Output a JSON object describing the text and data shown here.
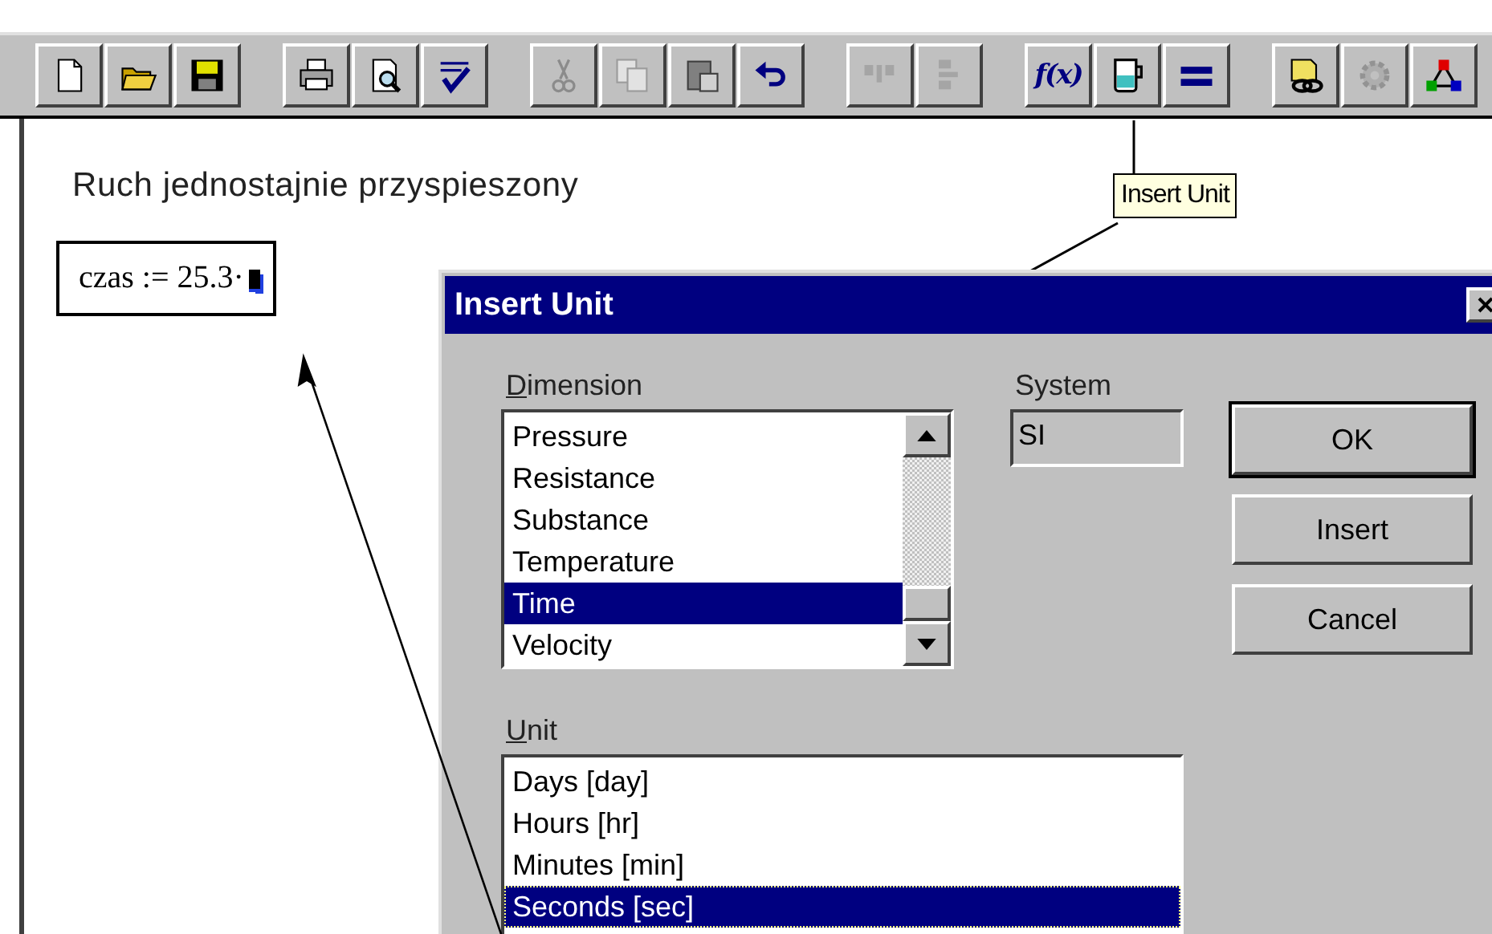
{
  "toolbar": {
    "groups": [
      {
        "buttons": [
          {
            "kind": "new",
            "disabled": false
          },
          {
            "kind": "open",
            "disabled": false
          },
          {
            "kind": "save",
            "disabled": false
          }
        ]
      },
      {
        "buttons": [
          {
            "kind": "print",
            "disabled": false
          },
          {
            "kind": "preview",
            "disabled": false
          },
          {
            "kind": "spell",
            "disabled": false
          }
        ]
      },
      {
        "buttons": [
          {
            "kind": "cut",
            "disabled": true
          },
          {
            "kind": "copy",
            "disabled": true
          },
          {
            "kind": "paste",
            "disabled": false
          },
          {
            "kind": "undo",
            "disabled": false
          }
        ]
      },
      {
        "buttons": [
          {
            "kind": "align-top",
            "disabled": true
          },
          {
            "kind": "align-left",
            "disabled": true
          }
        ]
      },
      {
        "buttons": [
          {
            "kind": "label",
            "label": "f(x)",
            "disabled": false
          },
          {
            "kind": "unit",
            "disabled": false
          },
          {
            "kind": "equals",
            "disabled": false
          }
        ]
      },
      {
        "buttons": [
          {
            "kind": "component",
            "disabled": false
          },
          {
            "kind": "gear",
            "disabled": true
          },
          {
            "kind": "tree",
            "disabled": false
          }
        ]
      }
    ]
  },
  "tooltip": {
    "text": "Insert Unit"
  },
  "document": {
    "heading": "Ruch jednostajnie przyspieszony",
    "math_region": "czas := 25.3·"
  },
  "dialog": {
    "title": "Insert Unit",
    "dimension": {
      "label": "Dimension",
      "items": [
        {
          "text": "Pressure",
          "selected": false
        },
        {
          "text": "Resistance",
          "selected": false
        },
        {
          "text": "Substance",
          "selected": false
        },
        {
          "text": "Temperature",
          "selected": false
        },
        {
          "text": "Time",
          "selected": true
        },
        {
          "text": "Velocity",
          "selected": false
        }
      ]
    },
    "system": {
      "label": "System",
      "value": "SI"
    },
    "buttons": [
      {
        "label": "OK",
        "default": true
      },
      {
        "label": "Insert",
        "default": false
      },
      {
        "label": "Cancel",
        "default": false
      }
    ],
    "unit": {
      "label": "Unit",
      "items": [
        {
          "text": "Days [day]",
          "selected": false
        },
        {
          "text": "Hours [hr]",
          "selected": false
        },
        {
          "text": "Minutes [min]",
          "selected": false
        },
        {
          "text": "Seconds [sec]",
          "selected": true
        }
      ]
    }
  }
}
